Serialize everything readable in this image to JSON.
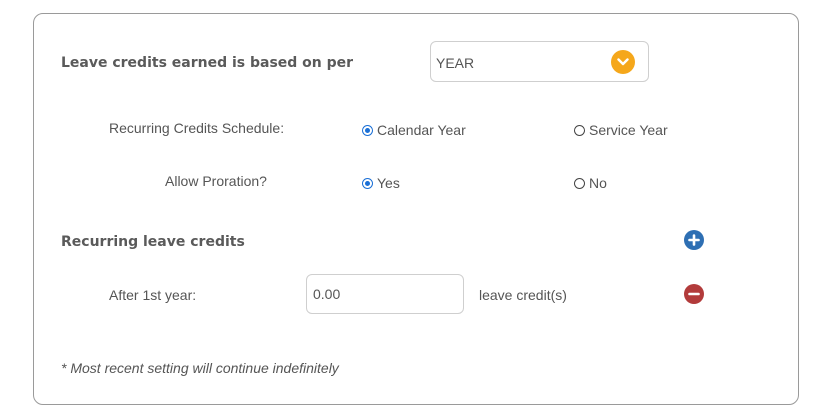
{
  "settings": {
    "earned_basis_label": "Leave credits earned is based on per",
    "period_select": {
      "value": "YEAR"
    },
    "schedule": {
      "label": "Recurring Credits Schedule:",
      "options": [
        {
          "label": "Calendar Year",
          "selected": true
        },
        {
          "label": "Service Year",
          "selected": false
        }
      ]
    },
    "proration": {
      "label": "Allow Proration?",
      "options": [
        {
          "label": "Yes",
          "selected": true
        },
        {
          "label": "No",
          "selected": false
        }
      ]
    },
    "recurring_heading": "Recurring leave credits",
    "rows": [
      {
        "label": "After 1st year:",
        "value": "0.00",
        "unit": "leave credit(s)"
      }
    ],
    "note": "* Most recent setting will continue indefinitely"
  },
  "icons": {
    "select_chevron": "chevron-down-icon",
    "add": "plus-icon",
    "remove": "minus-icon"
  },
  "colors": {
    "chevron_bg": "#f5a71b",
    "add_button": "#2e6fb3",
    "remove_button": "#b23b3b",
    "radio_selected": "#1a6fd6"
  }
}
